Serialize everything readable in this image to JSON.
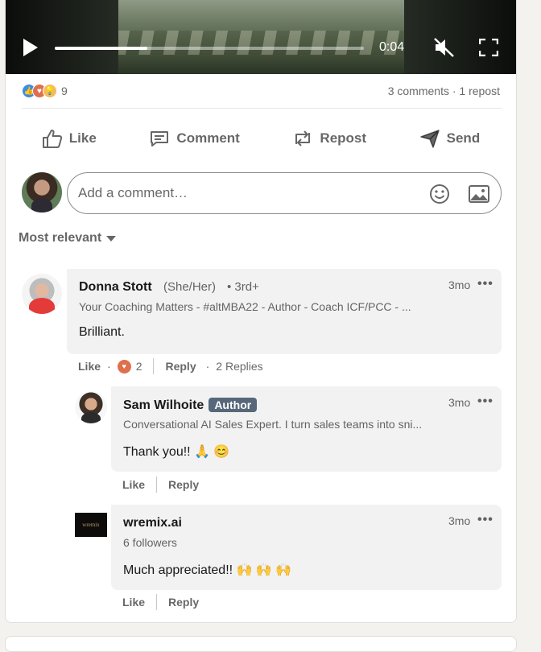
{
  "video": {
    "time": "0:04",
    "progress_percent": 30,
    "play_icon": "play-icon",
    "mute_icon": "volume-muted-icon",
    "fullscreen_icon": "fullscreen-icon"
  },
  "social": {
    "reaction_icons": [
      "like-icon",
      "love-icon",
      "insightful-icon"
    ],
    "reaction_count": "9",
    "comments_reposts": "3 comments · 1 repost"
  },
  "actions": {
    "like": "Like",
    "comment": "Comment",
    "repost": "Repost",
    "send": "Send"
  },
  "composer": {
    "placeholder": "Add a comment…"
  },
  "sort": {
    "label": "Most relevant"
  },
  "comments": [
    {
      "name": "Donna Stott",
      "pronouns": "(She/Her)",
      "degree": "• 3rd+",
      "headline": "Your Coaching Matters - #altMBA22 - Author - Coach ICF/PCC - ...",
      "text": "Brilliant.",
      "time": "3mo",
      "more": "•••",
      "like": "Like",
      "reaction_count": "2",
      "reply": "Reply",
      "replies": "2 Replies"
    },
    {
      "name": "Sam Wilhoite",
      "badge": "Author",
      "headline": "Conversational AI Sales Expert. I turn sales teams into sni...",
      "text": "Thank you!! 🙏 😊",
      "time": "3mo",
      "more": "•••",
      "like": "Like",
      "reply": "Reply"
    },
    {
      "name": "wremix.ai",
      "logo_text": "wremix",
      "headline": "6 followers",
      "text": "Much appreciated!! 🙌 🙌 🙌",
      "time": "3mo",
      "more": "•••",
      "like": "Like",
      "reply": "Reply"
    }
  ],
  "colors": {
    "like_blue": "#378fe9",
    "love_red": "#df704d",
    "insight_yellow": "#f5bb5c",
    "author_badge": "#56687a",
    "bubble_bg": "#f2f2f2"
  }
}
